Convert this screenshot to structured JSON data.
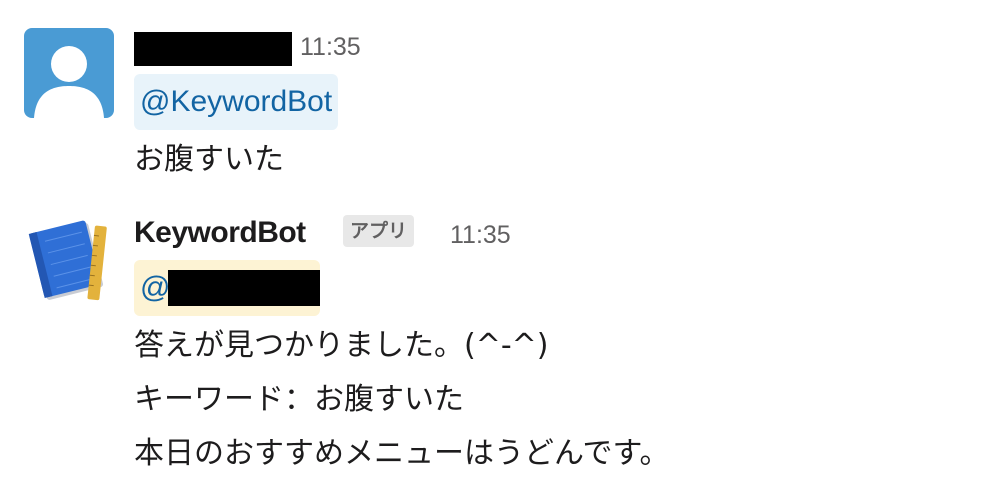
{
  "messages": [
    {
      "sender": "",
      "timestamp": "11:35",
      "mention": "@KeywordBot",
      "lines": [
        "お腹すいた"
      ],
      "avatar_icon": "default-user-avatar-icon"
    },
    {
      "sender": "KeywordBot",
      "badge": "アプリ",
      "timestamp": "11:35",
      "mention": "@",
      "lines": [
        "答えが見つかりました。(^-^)",
        "キーワード：お腹すいた",
        "本日のおすすめメニューはうどんです。"
      ],
      "avatar_icon": "notebook-ruler-icon"
    }
  ],
  "colors": {
    "mention_text": "#1264a3",
    "mention_bg_user": "#e8f3fa",
    "mention_bg_self": "#fdf3d4",
    "timestamp": "#616061",
    "badge_bg": "#e8e8e8"
  }
}
